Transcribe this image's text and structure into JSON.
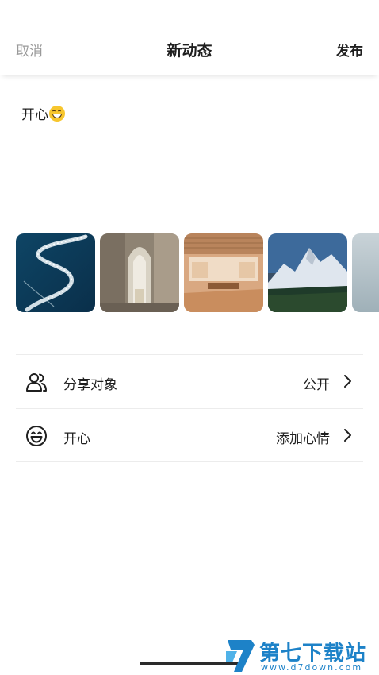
{
  "header": {
    "cancel_label": "取消",
    "title": "新动态",
    "publish_label": "发布"
  },
  "post": {
    "text": "开心",
    "emoji": "grinning-face-emoji"
  },
  "photos": [
    {
      "name": "aerial-ocean-boat-photo"
    },
    {
      "name": "arched-corridor-photo"
    },
    {
      "name": "wooden-interior-room-photo"
    },
    {
      "name": "snowy-mountain-forest-photo"
    },
    {
      "name": "misty-grey-photo"
    }
  ],
  "options": [
    {
      "icon": "users-icon",
      "label": "分享对象",
      "value": "公开"
    },
    {
      "icon": "smile-face-icon",
      "label": "开心",
      "value": "添加心情"
    }
  ],
  "watermark": {
    "name": "第七下载站",
    "url": "www.d7down.com",
    "color": "#1d82c8"
  }
}
